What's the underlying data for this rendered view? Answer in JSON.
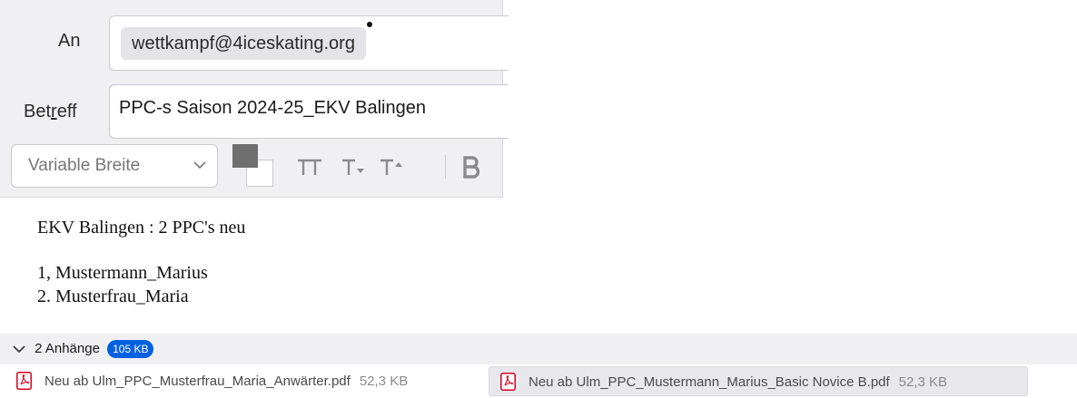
{
  "header": {
    "to_label": "An",
    "to_recipient": "wettkampf@4iceskating.org",
    "subject_label_before": "Bet",
    "subject_label_accel": "r",
    "subject_label_after": "eff",
    "subject_value": "PPC-s Saison 2024-25_EKV Balingen"
  },
  "toolbar": {
    "font_select_value": "Variable Breite",
    "text_color": "#6f6f6f",
    "background_color": "#ffffff",
    "icons": [
      "reset-size-icon",
      "smaller-size-icon",
      "larger-size-icon",
      "bold-icon"
    ]
  },
  "body": {
    "line1": "EKV Balingen : 2 PPC's neu",
    "line2": "1, Mustermann_Marius",
    "line3": "2. Musterfrau_Maria"
  },
  "attachments": {
    "toggle_label": "2 Anhänge",
    "total_size": "105 KB",
    "accent_color": "#0061e0",
    "items": [
      {
        "name": "Neu ab Ulm_PPC_Musterfrau_Maria_Anwärter.pdf",
        "size": "52,3 KB",
        "icon": "pdf-icon",
        "selected": false
      },
      {
        "name": "Neu ab Ulm_PPC_Mustermann_Marius_Basic Novice B.pdf",
        "size": "52,3 KB",
        "icon": "pdf-icon",
        "selected": true
      }
    ]
  }
}
